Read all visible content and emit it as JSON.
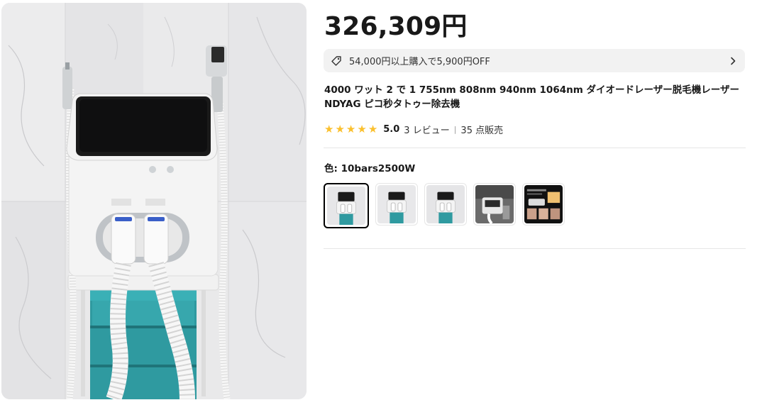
{
  "product": {
    "price": "326,309円",
    "coupon": {
      "text": "54,000円以上購入で5,900円OFF",
      "icon": "tag-icon"
    },
    "title": "4000 ワット 2 で 1 755nm 808nm 940nm 1064nm ダイオードレーザー脱毛機レーザー NDYAG ピコ秒タトゥー除去機",
    "rating": {
      "score": "5.0",
      "stars": 5,
      "reviews": "3 レビュー",
      "sold": "35 点販売"
    },
    "color": {
      "label": "色: 10bars2500W",
      "selected_index": 0,
      "option_count": 5
    }
  },
  "colors": {
    "star": "#fbc02d",
    "device_body": "#f4f4f4",
    "cabinet": "#2f9aa0"
  }
}
